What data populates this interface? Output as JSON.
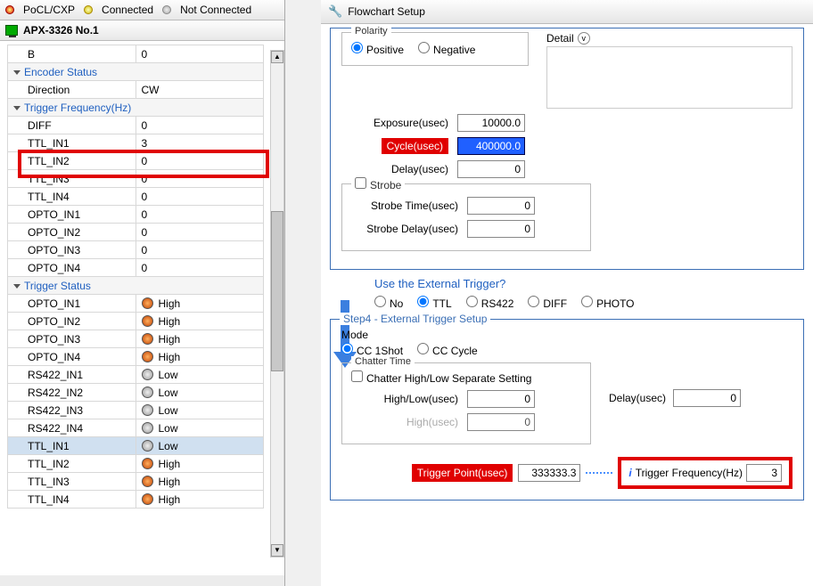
{
  "legend": {
    "pocl": "PoCL/CXP",
    "connected": "Connected",
    "notConnected": "Not Connected"
  },
  "device": {
    "name": "APX-3326 No.1"
  },
  "tree": {
    "rowB": {
      "label": "B",
      "value": "0"
    },
    "sec_encoder": "Encoder Status",
    "direction": {
      "label": "Direction",
      "value": "CW"
    },
    "sec_trigfreq": "Trigger Frequency(Hz)",
    "diff": {
      "label": "DIFF",
      "value": "0"
    },
    "ttl1": {
      "label": "TTL_IN1",
      "value": "3"
    },
    "ttl2": {
      "label": "TTL_IN2",
      "value": "0"
    },
    "ttl3": {
      "label": "TTL_IN3",
      "value": "0"
    },
    "ttl4": {
      "label": "TTL_IN4",
      "value": "0"
    },
    "opto1": {
      "label": "OPTO_IN1",
      "value": "0"
    },
    "opto2": {
      "label": "OPTO_IN2",
      "value": "0"
    },
    "opto3": {
      "label": "OPTO_IN3",
      "value": "0"
    },
    "opto4": {
      "label": "OPTO_IN4",
      "value": "0"
    },
    "sec_trigstat": "Trigger Status",
    "s_opto1": {
      "label": "OPTO_IN1",
      "value": "High"
    },
    "s_opto2": {
      "label": "OPTO_IN2",
      "value": "High"
    },
    "s_opto3": {
      "label": "OPTO_IN3",
      "value": "High"
    },
    "s_opto4": {
      "label": "OPTO_IN4",
      "value": "High"
    },
    "s_rs1": {
      "label": "RS422_IN1",
      "value": "Low"
    },
    "s_rs2": {
      "label": "RS422_IN2",
      "value": "Low"
    },
    "s_rs3": {
      "label": "RS422_IN3",
      "value": "Low"
    },
    "s_rs4": {
      "label": "RS422_IN4",
      "value": "Low"
    },
    "s_ttl1": {
      "label": "TTL_IN1",
      "value": "Low"
    },
    "s_ttl2": {
      "label": "TTL_IN2",
      "value": "High"
    },
    "s_ttl3": {
      "label": "TTL_IN3",
      "value": "High"
    },
    "s_ttl4": {
      "label": "TTL_IN4",
      "value": "High"
    }
  },
  "right": {
    "title": "Flowchart Setup",
    "polarity": {
      "legend": "Polarity",
      "positive": "Positive",
      "negative": "Negative"
    },
    "detail": "Detail",
    "exposure": {
      "label": "Exposure(usec)",
      "value": "10000.0"
    },
    "cycle": {
      "label": "Cycle(usec)",
      "value": "400000.0"
    },
    "delay": {
      "label": "Delay(usec)",
      "value": "0"
    },
    "strobe": {
      "legend": "Strobe",
      "time": "Strobe Time(usec)",
      "timeV": "0",
      "delay": "Strobe Delay(usec)",
      "delayV": "0"
    },
    "question": "Use the External Trigger?",
    "extOpts": {
      "no": "No",
      "ttl": "TTL",
      "rs": "RS422",
      "diff": "DIFF",
      "photo": "PHOTO"
    },
    "step4": "Step4 - External Trigger Setup",
    "mode": {
      "legend": "Mode",
      "oneshot": "CC 1Shot",
      "cycle": "CC Cycle"
    },
    "chatter": {
      "legend": "Chatter Time",
      "sep": "Chatter High/Low Separate Setting",
      "hl": "High/Low(usec)",
      "hlV": "0",
      "h": "High(usec)",
      "hV": "0"
    },
    "delay2": {
      "label": "Delay(usec)",
      "value": "0"
    },
    "tp": {
      "label": "Trigger Point(usec)",
      "value": "333333.3"
    },
    "tf": {
      "label": "Trigger Frequency(Hz)",
      "value": "3"
    }
  }
}
